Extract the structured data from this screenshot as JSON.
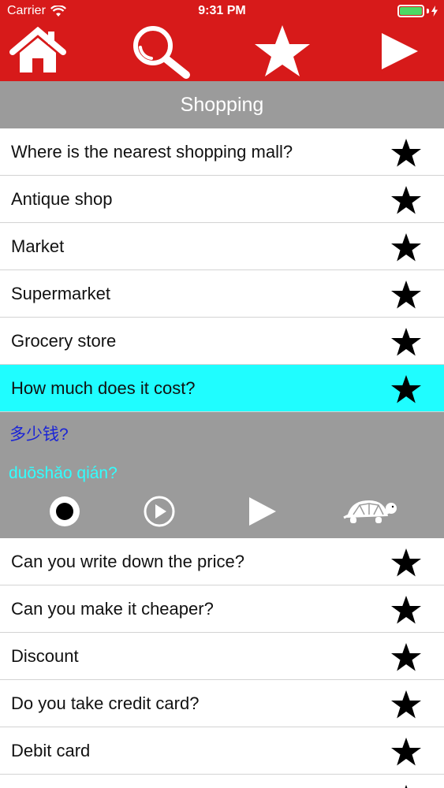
{
  "status_bar": {
    "carrier": "Carrier",
    "time": "9:31 PM",
    "battery_color": "#4cd964"
  },
  "toolbar": {
    "icons": [
      "home-icon",
      "search-icon",
      "star-icon",
      "play-icon"
    ],
    "background": "#d71a1a"
  },
  "category": {
    "title": "Shopping"
  },
  "phrases": [
    {
      "text": "Where is the nearest shopping mall?"
    },
    {
      "text": "Antique shop"
    },
    {
      "text": "Market"
    },
    {
      "text": "Supermarket"
    },
    {
      "text": "Grocery store"
    },
    {
      "text": "How much does it cost?",
      "selected": true
    },
    {
      "text": "Can you write down the price?"
    },
    {
      "text": "Can you make it cheaper?"
    },
    {
      "text": "Discount"
    },
    {
      "text": "Do you take credit card?"
    },
    {
      "text": "Debit card"
    }
  ],
  "selected_detail": {
    "chinese": "多少钱?",
    "pinyin": "duōshǎo qián?",
    "controls": [
      "record-icon",
      "play-recording-icon",
      "play-icon",
      "slow-play-turtle-icon"
    ]
  },
  "colors": {
    "selected_row": "#1ffdff",
    "header": "#9b9b9b",
    "chinese_text": "#1a24d6",
    "pinyin_text": "#31ffff"
  }
}
